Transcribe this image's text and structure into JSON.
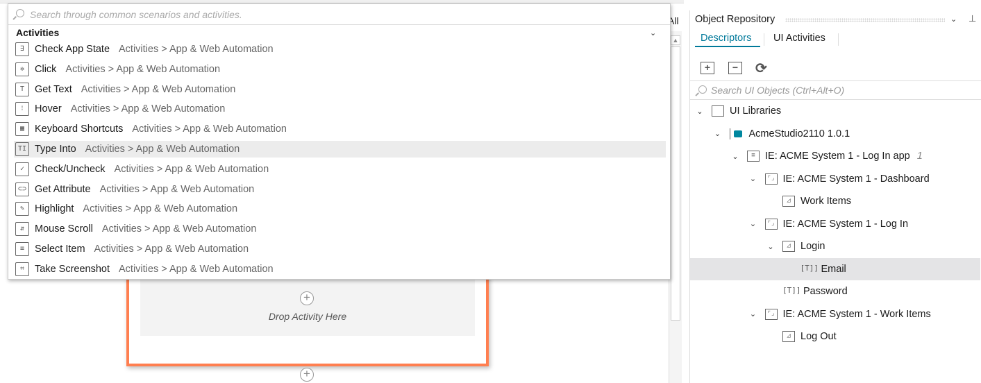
{
  "designer": {
    "all_label": "All",
    "drop_text": "Drop Activity Here",
    "accent": "#ff7f50"
  },
  "popup": {
    "search_placeholder": "Search through common scenarios and activities.",
    "category": "Activities",
    "items": [
      {
        "name": "Check App State",
        "path": "Activities > App & Web Automation",
        "icon": "check-app-state-icon",
        "glyph": "∃"
      },
      {
        "name": "Click",
        "path": "Activities > App & Web Automation",
        "icon": "click-icon",
        "glyph": "✲"
      },
      {
        "name": "Get Text",
        "path": "Activities > App & Web Automation",
        "icon": "get-text-icon",
        "glyph": "T"
      },
      {
        "name": "Hover",
        "path": "Activities > App & Web Automation",
        "icon": "hover-icon",
        "glyph": "⁝"
      },
      {
        "name": "Keyboard Shortcuts",
        "path": "Activities > App & Web Automation",
        "icon": "keyboard-shortcuts-icon",
        "glyph": "▦"
      },
      {
        "name": "Type Into",
        "path": "Activities > App & Web Automation",
        "icon": "type-into-icon",
        "glyph": "TI"
      },
      {
        "name": "Check/Uncheck",
        "path": "Activities > App & Web Automation",
        "icon": "checkbox-icon",
        "glyph": "✓"
      },
      {
        "name": "Get Attribute",
        "path": "Activities > App & Web Automation",
        "icon": "get-attribute-icon",
        "glyph": "⊂⊃"
      },
      {
        "name": "Highlight",
        "path": "Activities > App & Web Automation",
        "icon": "highlight-icon",
        "glyph": "✎"
      },
      {
        "name": "Mouse Scroll",
        "path": "Activities > App & Web Automation",
        "icon": "mouse-scroll-icon",
        "glyph": "⇵"
      },
      {
        "name": "Select Item",
        "path": "Activities > App & Web Automation",
        "icon": "select-item-icon",
        "glyph": "≡"
      },
      {
        "name": "Take Screenshot",
        "path": "Activities > App & Web Automation",
        "icon": "screenshot-icon",
        "glyph": "⌗"
      }
    ],
    "selected_index": 5
  },
  "repo": {
    "title": "Object Repository",
    "tabs": [
      {
        "label": "Descriptors",
        "active": true
      },
      {
        "label": "UI Activities",
        "active": false
      }
    ],
    "accent": "#00799a",
    "search_placeholder": "Search UI Objects (Ctrl+Alt+O)",
    "tree": [
      {
        "label": "UI Libraries",
        "level": 0,
        "expanded": true,
        "icon": "libraries"
      },
      {
        "label": "AcmeStudio2110 1.0.1",
        "level": 1,
        "expanded": true,
        "icon": "lib"
      },
      {
        "label": "IE: ACME System 1 - Log In app",
        "level": 2,
        "expanded": true,
        "icon": "app",
        "count": "1"
      },
      {
        "label": "IE: ACME System 1 - Dashboard",
        "level": 3,
        "expanded": true,
        "icon": "screen"
      },
      {
        "label": "Work Items",
        "level": 4,
        "icon": "element"
      },
      {
        "label": "IE: ACME System 1 - Log In",
        "level": 3,
        "expanded": true,
        "icon": "screen"
      },
      {
        "label": "Login",
        "level": 4,
        "expanded": true,
        "icon": "element"
      },
      {
        "label": "Email",
        "level": 5,
        "icon": "text",
        "selected": true
      },
      {
        "label": "Password",
        "level": 4,
        "icon": "text"
      },
      {
        "label": "IE: ACME System 1 - Work Items",
        "level": 3,
        "expanded": true,
        "icon": "screen"
      },
      {
        "label": "Log Out",
        "level": 4,
        "icon": "element"
      }
    ]
  }
}
